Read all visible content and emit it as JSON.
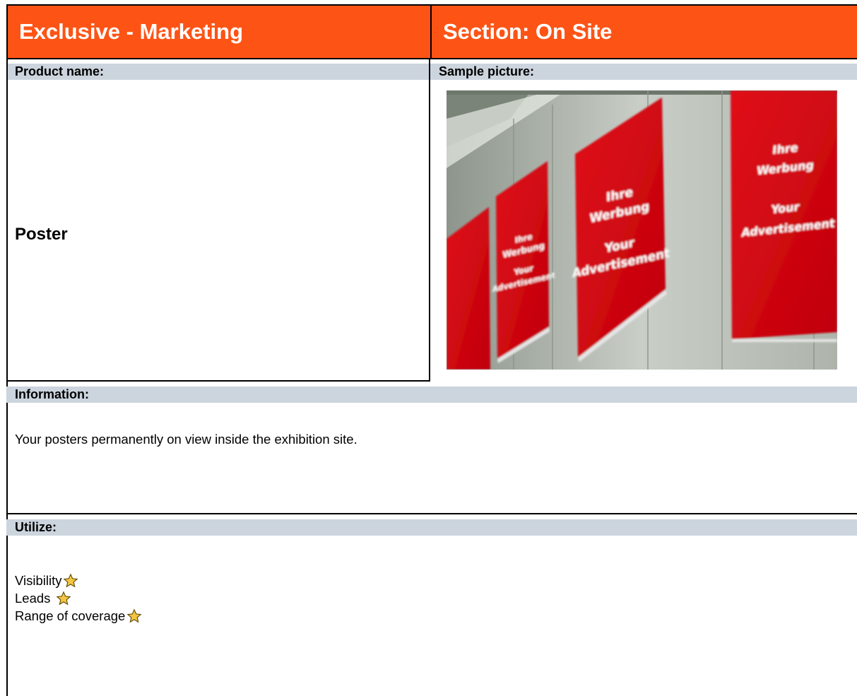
{
  "header": {
    "left_title": "Exclusive - Marketing",
    "right_title": "Section: On Site"
  },
  "labels": {
    "product_name": "Product name:",
    "sample_picture": "Sample picture:",
    "information": "Information:",
    "utilize": "Utilize:"
  },
  "product": {
    "name": "Poster"
  },
  "information_text": "Your posters permanently on view inside the exhibition site.",
  "utilize_items": [
    {
      "label": "Visibility",
      "stars": 1
    },
    {
      "label": "Leads",
      "stars": 1
    },
    {
      "label": "Range of coverage",
      "stars": 1
    }
  ],
  "poster_text": {
    "line1": "Ihre",
    "line2": "Werbung",
    "line3": "Your",
    "line4": "Advertisement"
  },
  "colors": {
    "header_orange": "#fd5416",
    "label_gray": "#ccd4de",
    "poster_red": "#d0000b",
    "star_yellow": "#f5c542"
  }
}
